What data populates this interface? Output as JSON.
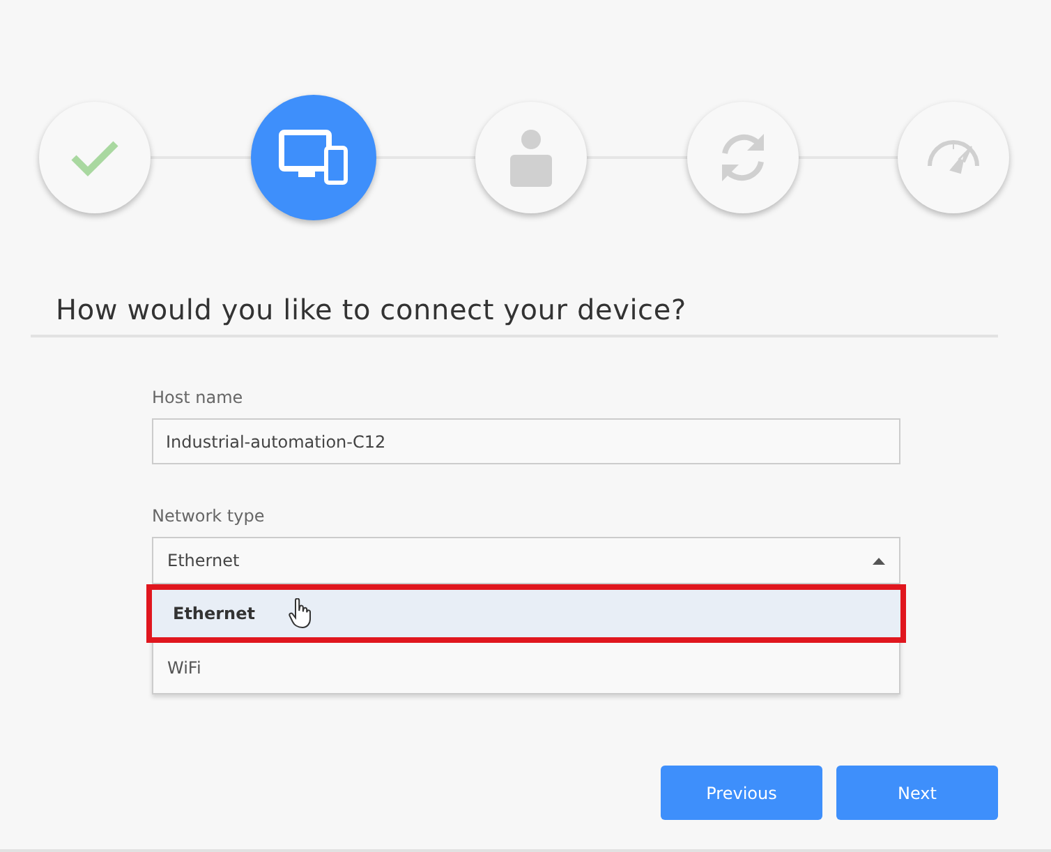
{
  "steps": [
    {
      "kind": "check",
      "done": true,
      "selected": false
    },
    {
      "kind": "devices",
      "done": false,
      "selected": true
    },
    {
      "kind": "person",
      "done": false,
      "selected": false
    },
    {
      "kind": "sync",
      "done": false,
      "selected": false
    },
    {
      "kind": "gauge",
      "done": false,
      "selected": false
    }
  ],
  "heading": "How would you like to connect your device?",
  "host": {
    "label": "Host name",
    "value": "Industrial-automation-C12"
  },
  "network": {
    "label": "Network type",
    "value": "Ethernet",
    "expanded": true,
    "options": [
      {
        "label": "Ethernet",
        "selected": true,
        "hovered": true,
        "outlined": true
      },
      {
        "label": "WiFi",
        "selected": false,
        "hovered": false,
        "outlined": false
      }
    ]
  },
  "buttons": [
    "Previous",
    "Next"
  ]
}
